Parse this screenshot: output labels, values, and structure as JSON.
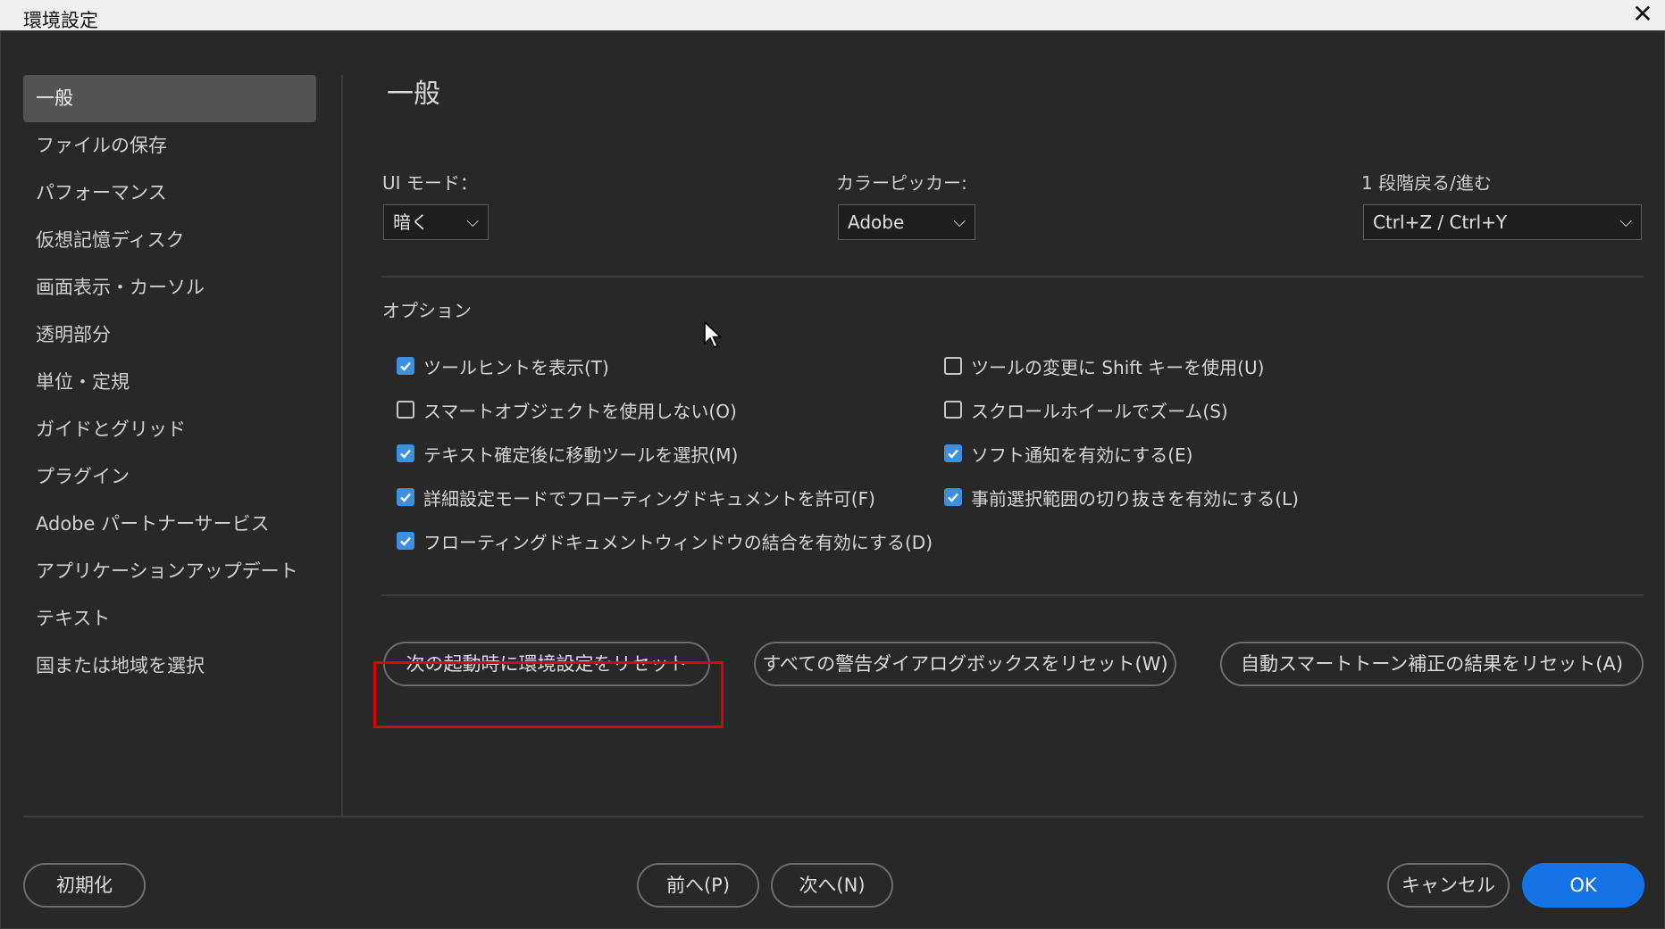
{
  "window": {
    "title": "環境設定",
    "close_glyph": "✕"
  },
  "sidebar": {
    "items": [
      {
        "label": "一般",
        "active": true
      },
      {
        "label": "ファイルの保存"
      },
      {
        "label": "パフォーマンス"
      },
      {
        "label": "仮想記憶ディスク"
      },
      {
        "label": "画面表示・カーソル"
      },
      {
        "label": "透明部分"
      },
      {
        "label": "単位・定規"
      },
      {
        "label": "ガイドとグリッド"
      },
      {
        "label": "プラグイン"
      },
      {
        "label": "Adobe パートナーサービス"
      },
      {
        "label": "アプリケーションアップデート"
      },
      {
        "label": "テキスト"
      },
      {
        "label": "国または地域を選択"
      }
    ]
  },
  "main": {
    "heading": "一般",
    "ui_mode": {
      "label": "UI モード：",
      "value": "暗く"
    },
    "color_picker": {
      "label": "カラーピッカー:",
      "value": "Adobe"
    },
    "undo_step": {
      "label": "1 段階戻る/進む",
      "value": "Ctrl+Z / Ctrl+Y"
    },
    "options_label": "オプション",
    "options_left": [
      {
        "label": "ツールヒントを表示(T)",
        "checked": true
      },
      {
        "label": "スマートオブジェクトを使用しない(O)",
        "checked": false
      },
      {
        "label": "テキスト確定後に移動ツールを選択(M)",
        "checked": true
      },
      {
        "label": "詳細設定モードでフローティングドキュメントを許可(F)",
        "checked": true
      },
      {
        "label": "フローティングドキュメントウィンドウの結合を有効にする(D)",
        "checked": true
      }
    ],
    "options_right": [
      {
        "label": "ツールの変更に Shift キーを使用(U)",
        "checked": false
      },
      {
        "label": "スクロールホイールでズーム(S)",
        "checked": false
      },
      {
        "label": "ソフト通知を有効にする(E)",
        "checked": true
      },
      {
        "label": "事前選択範囲の切り抜きを有効にする(L)",
        "checked": true
      }
    ],
    "reset_buttons": {
      "reset_prefs": "次の起動時に環境設定をリセット",
      "reset_warnings": "すべての警告ダイアログボックスをリセット(W)",
      "reset_auto_tone": "自動スマートトーン補正の結果をリセット(A)"
    }
  },
  "footer": {
    "reset": "初期化",
    "prev": "前へ(P)",
    "next": "次へ(N)",
    "cancel": "キャンセル",
    "ok": "OK"
  },
  "colors": {
    "accent": "#1473e6",
    "checkbox": "#3d8fe0",
    "highlight": "#e00000",
    "background": "#282828"
  }
}
